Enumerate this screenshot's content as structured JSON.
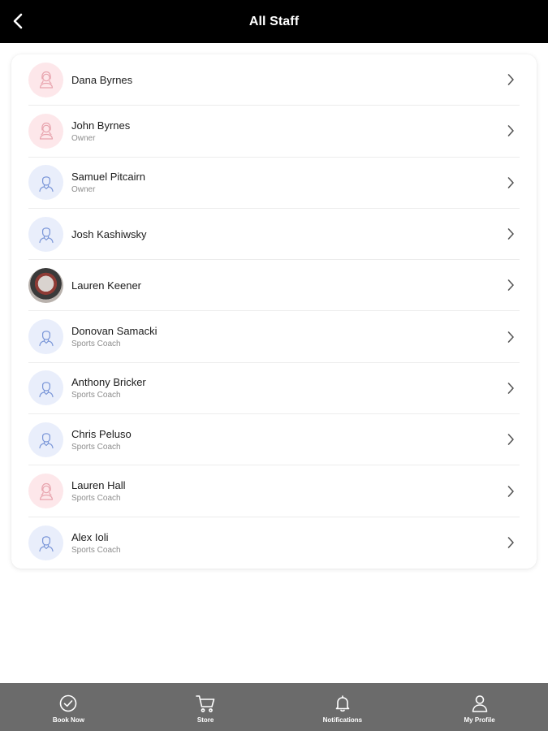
{
  "header": {
    "title": "All Staff",
    "back_icon": "chevron-left-icon"
  },
  "staff": [
    {
      "name": "Dana Byrnes",
      "role": "",
      "avatar": "female"
    },
    {
      "name": "John Byrnes",
      "role": "Owner",
      "avatar": "female"
    },
    {
      "name": "Samuel Pitcairn",
      "role": "Owner",
      "avatar": "male"
    },
    {
      "name": "Josh Kashiwsky",
      "role": "",
      "avatar": "male"
    },
    {
      "name": "Lauren Keener",
      "role": "",
      "avatar": "photo"
    },
    {
      "name": "Donovan Samacki",
      "role": "Sports Coach",
      "avatar": "male"
    },
    {
      "name": "Anthony Bricker",
      "role": "Sports Coach",
      "avatar": "male"
    },
    {
      "name": "Chris Peluso",
      "role": "Sports Coach",
      "avatar": "male"
    },
    {
      "name": "Lauren Hall",
      "role": "Sports Coach",
      "avatar": "female"
    },
    {
      "name": "Alex Ioli",
      "role": "Sports Coach",
      "avatar": "male"
    }
  ],
  "bottom_nav": [
    {
      "label": "Book Now",
      "icon": "check-circle-icon"
    },
    {
      "label": "Store",
      "icon": "cart-icon"
    },
    {
      "label": "Notifications",
      "icon": "bell-icon"
    },
    {
      "label": "My Profile",
      "icon": "user-icon"
    }
  ],
  "colors": {
    "header_bg": "#000000",
    "nav_bg": "#6b6b6b",
    "female_avatar_bg": "#fde7ea",
    "female_avatar_stroke": "#e8a4ae",
    "male_avatar_bg": "#e9eefb",
    "male_avatar_stroke": "#7a96d8"
  }
}
